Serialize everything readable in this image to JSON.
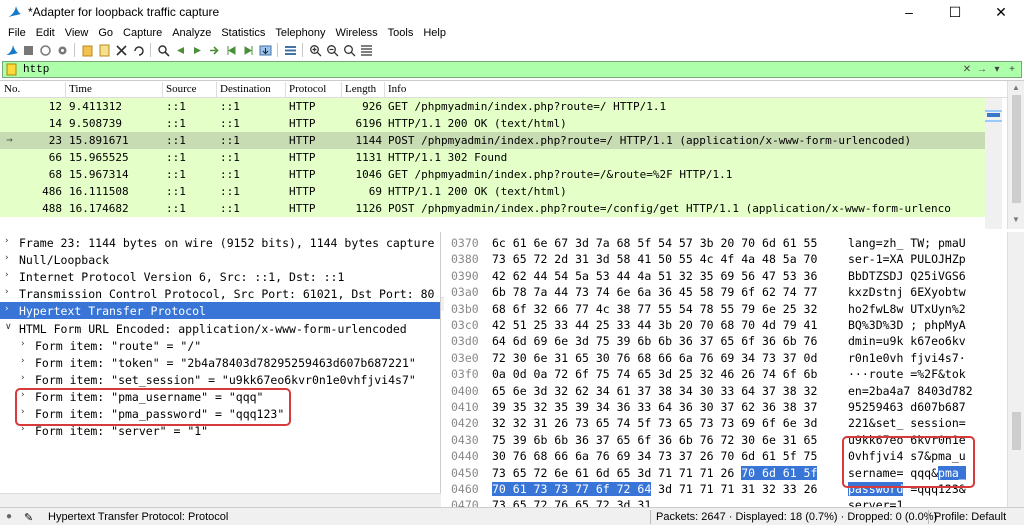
{
  "window": {
    "title": "*Adapter for loopback traffic capture"
  },
  "menu": [
    "File",
    "Edit",
    "View",
    "Go",
    "Capture",
    "Analyze",
    "Statistics",
    "Telephony",
    "Wireless",
    "Tools",
    "Help"
  ],
  "toolbar": {
    "icons": [
      "shark-fin-start-icon",
      "stop-icon",
      "restart-icon",
      "capture-options-icon",
      "open-file-icon",
      "save-file-icon",
      "close-file-icon",
      "reload-icon",
      "find-packet-icon",
      "go-back-icon",
      "go-forward-icon",
      "go-to-packet-icon",
      "first-packet-icon",
      "last-packet-icon",
      "autoscroll-icon",
      "colorize-icon",
      "zoom-in-icon",
      "zoom-out-icon",
      "normal-size-icon",
      "resize-columns-icon"
    ]
  },
  "filter": {
    "value": "http"
  },
  "packet_list": {
    "columns": [
      "No.",
      "Time",
      "Source",
      "Destination",
      "Protocol",
      "Length",
      "Info"
    ],
    "rows": [
      {
        "no": "12",
        "time": "9.411312",
        "src": "::1",
        "dst": "::1",
        "proto": "HTTP",
        "len": "926",
        "info": "GET /phpmyadmin/index.php?route=/ HTTP/1.1",
        "selected": false
      },
      {
        "no": "14",
        "time": "9.508739",
        "src": "::1",
        "dst": "::1",
        "proto": "HTTP",
        "len": "6196",
        "info": "HTTP/1.1 200 OK  (text/html)",
        "selected": false
      },
      {
        "no": "23",
        "time": "15.891671",
        "src": "::1",
        "dst": "::1",
        "proto": "HTTP",
        "len": "1144",
        "info": "POST /phpmyadmin/index.php?route=/ HTTP/1.1  (application/x-www-form-urlencoded)",
        "selected": true
      },
      {
        "no": "66",
        "time": "15.965525",
        "src": "::1",
        "dst": "::1",
        "proto": "HTTP",
        "len": "1131",
        "info": "HTTP/1.1 302 Found",
        "selected": false
      },
      {
        "no": "68",
        "time": "15.967314",
        "src": "::1",
        "dst": "::1",
        "proto": "HTTP",
        "len": "1046",
        "info": "GET /phpmyadmin/index.php?route=/&route=%2F HTTP/1.1",
        "selected": false
      },
      {
        "no": "486",
        "time": "16.111508",
        "src": "::1",
        "dst": "::1",
        "proto": "HTTP",
        "len": "69",
        "info": "HTTP/1.1 200 OK  (text/html)",
        "selected": false
      },
      {
        "no": "488",
        "time": "16.174682",
        "src": "::1",
        "dst": "::1",
        "proto": "HTTP",
        "len": "1126",
        "info": "POST /phpmyadmin/index.php?route=/config/get HTTP/1.1  (application/x-www-form-urlenco",
        "selected": false
      }
    ]
  },
  "details": {
    "rows": [
      {
        "indent": 0,
        "exp": ">",
        "text": "Frame 23: 1144 bytes on wire (9152 bits), 1144 bytes capture",
        "selected": false
      },
      {
        "indent": 0,
        "exp": ">",
        "text": "Null/Loopback",
        "selected": false
      },
      {
        "indent": 0,
        "exp": ">",
        "text": "Internet Protocol Version 6, Src: ::1, Dst: ::1",
        "selected": false
      },
      {
        "indent": 0,
        "exp": ">",
        "text": "Transmission Control Protocol, Src Port: 61021, Dst Port: 80",
        "selected": false
      },
      {
        "indent": 0,
        "exp": ">",
        "text": "Hypertext Transfer Protocol",
        "selected": true
      },
      {
        "indent": 0,
        "exp": "v",
        "text": "HTML Form URL Encoded: application/x-www-form-urlencoded",
        "selected": false
      },
      {
        "indent": 1,
        "exp": ">",
        "text": "Form item: \"route\" = \"/\"",
        "selected": false
      },
      {
        "indent": 1,
        "exp": ">",
        "text": "Form item: \"token\" = \"2b4a78403d78295259463d607b687221\"",
        "selected": false
      },
      {
        "indent": 1,
        "exp": ">",
        "text": "Form item: \"set_session\" = \"u9kk67eo6kvr0n1e0vhfjvi4s7\"",
        "selected": false
      },
      {
        "indent": 1,
        "exp": ">",
        "text": "Form item: \"pma_username\" = \"qqq\"",
        "selected": false
      },
      {
        "indent": 1,
        "exp": ">",
        "text": "Form item: \"pma_password\" = \"qqq123\"",
        "selected": false
      },
      {
        "indent": 1,
        "exp": ">",
        "text": "Form item: \"server\" = \"1\"",
        "selected": false
      }
    ]
  },
  "bytes": {
    "rows": [
      {
        "off": "0370",
        "hex": [
          "6c 61 6e 67 3d 7a 68 5f  54 57 3b 20 70 6d 61 55"
        ],
        "asc": [
          "lang=zh_ TW; pmaU"
        ]
      },
      {
        "off": "0380",
        "hex": [
          "73 65 72 2d 31 3d 58 41  50 55 4c 4f 4a 48 5a 70"
        ],
        "asc": [
          "ser-1=XA PULOJHZp"
        ]
      },
      {
        "off": "0390",
        "hex": [
          "42 62 44 54 5a 53 44 4a  51 32 35 69 56 47 53 36"
        ],
        "asc": [
          "BbDTZSDJ Q25iVGS6"
        ]
      },
      {
        "off": "03a0",
        "hex": [
          "6b 78 7a 44 73 74 6e 6a  36 45 58 79 6f 62 74 77"
        ],
        "asc": [
          "kxzDstnj 6EXyobtw"
        ]
      },
      {
        "off": "03b0",
        "hex": [
          "68 6f 32 66 77 4c 38 77  55 54 78 55 79 6e 25 32"
        ],
        "asc": [
          "ho2fwL8w UTxUyn%2"
        ]
      },
      {
        "off": "03c0",
        "hex": [
          "42 51 25 33 44 25 33 44  3b 20 70 68 70 4d 79 41"
        ],
        "asc": [
          "BQ%3D%3D ; phpMyA"
        ]
      },
      {
        "off": "03d0",
        "hex": [
          "64 6d 69 6e 3d 75 39 6b  6b 36 37 65 6f 36 6b 76"
        ],
        "asc": [
          "dmin=u9k k67eo6kv"
        ]
      },
      {
        "off": "03e0",
        "hex": [
          "72 30 6e 31 65 30 76 68  66 6a 76 69 34 73 37 0d"
        ],
        "asc": [
          "r0n1e0vh fjvi4s7·"
        ]
      },
      {
        "off": "03f0",
        "hex": [
          "0a 0d 0a 72 6f 75 74 65  3d 25 32 46 26 74 6f 6b"
        ],
        "asc": [
          "···route =%2F&tok"
        ]
      },
      {
        "off": "0400",
        "hex": [
          "65 6e 3d 32 62 34 61 37  38 34 30 33 64 37 38 32"
        ],
        "asc": [
          "en=2ba4a7 8403d782"
        ]
      },
      {
        "off": "0410",
        "hex": [
          "39 35 32 35 39 34 36 33  64 36 30 37 62 36 38 37"
        ],
        "asc": [
          "95259463 d607b687"
        ]
      },
      {
        "off": "0420",
        "hex": [
          "32 32 31 26 73 65 74 5f  73 65 73 73 69 6f 6e 3d"
        ],
        "asc": [
          "221&set_ session="
        ]
      },
      {
        "off": "0430",
        "hex": [
          "75 39 6b 6b 36 37 65 6f  36 6b 76 72 30 6e 31 65"
        ],
        "asc": [
          "u9kk67eo 6kvr0n1e"
        ]
      },
      {
        "off": "0440",
        "hex": [
          "30 76 68 66 6a 76 69 34  73 37 26 70 6d 61 5f 75"
        ],
        "asc": [
          "0vhfjvi4 s7&pma_u"
        ]
      },
      {
        "off": "0450",
        "hex": [
          "73 65 72 6e 61 6d 65 3d  71 71 71 26 ",
          "70 6d 61 5f",
          ""
        ],
        "asc": [
          "sername= qqq&",
          "pma_",
          ""
        ]
      },
      {
        "off": "0460",
        "hex": [
          "",
          "70 61 73 73 77 6f 72 64",
          "  3d 71 71 71 31 32 33 26"
        ],
        "asc": [
          "",
          "password",
          " =qqq123&"
        ]
      },
      {
        "off": "0470",
        "hex": [
          "73 65 72 76 65 72 3d 31"
        ],
        "asc": [
          "server=1"
        ]
      }
    ]
  },
  "status": {
    "protocol": "Hypertext Transfer Protocol: Protocol",
    "packets": "Packets: 2647 · Displayed: 18 (0.7%) · Dropped: 0 (0.0%)",
    "profile": "Profile: Default"
  },
  "colors": {
    "row_http": "#e4ffc7",
    "row_selected": "#c8dcb4",
    "filter_ok": "#aeffaa",
    "selection": "#3875d7",
    "highlight_box": "#d63a3a"
  }
}
